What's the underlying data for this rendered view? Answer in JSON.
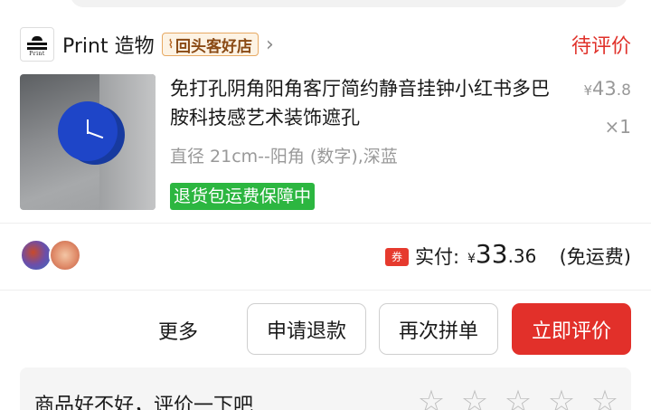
{
  "store": {
    "logo_text": "Print",
    "name": "Print 造物",
    "badge_icon": "ladder-icon",
    "badge_label": "回头客好店",
    "status": "待评价"
  },
  "product": {
    "title": "免打孔阴角阳角客厅简约静音挂钟小红书多巴胺科技感艺术装饰遮孔",
    "price_currency": "¥",
    "price_int": "43",
    "price_decimal": ".8",
    "quantity": "×1",
    "variant": "直径 21cm--阳角 (数字),深蓝",
    "return_badge": "退货包运费保障中"
  },
  "payment": {
    "coupon_icon_text": "券",
    "paid_label": "实付:",
    "currency": "¥",
    "amount_int": "33",
    "amount_decimal": ".36",
    "shipping_note": "(免运费)"
  },
  "actions": {
    "more": "更多",
    "refund": "申请退款",
    "reorder": "再次拼单",
    "review_now": "立即评价"
  },
  "review": {
    "prompt": "商品好不好，评价一下吧",
    "star_count_max": 5,
    "stars_selected": 0
  },
  "colors": {
    "accent_red": "#e2302a",
    "status_red": "#e0322b",
    "return_green": "#2cb640",
    "badge_bg": "#fdf3e4",
    "muted_text": "#999999"
  }
}
